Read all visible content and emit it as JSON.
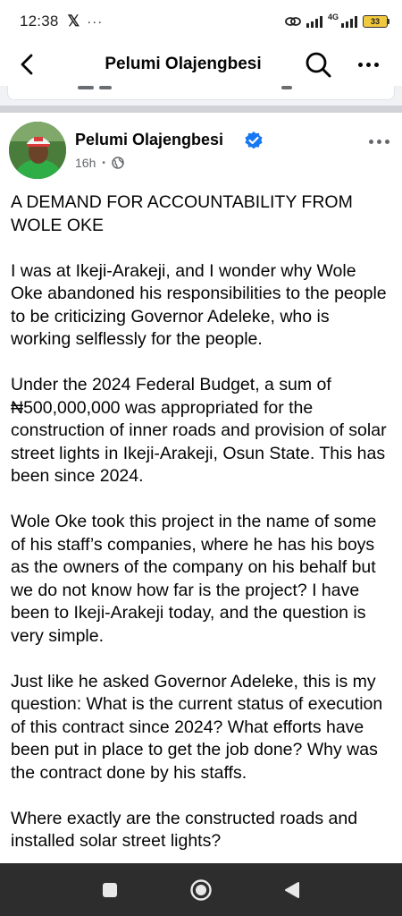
{
  "status_bar": {
    "time": "12:38",
    "x_glyph": "𝕏",
    "dots": "···",
    "network": "4G",
    "battery": "33"
  },
  "app_bar": {
    "title": "Pelumi Olajengbesi"
  },
  "post": {
    "author": "Pelumi Olajengbesi",
    "time": "16h",
    "separator": "•",
    "paragraphs": [
      "A DEMAND FOR ACCOUNTABILITY FROM WOLE OKE",
      "I was at Ikeji-Arakeji, and I wonder why Wole Oke abandoned his responsibilities to the people to be criticizing Governor Adeleke, who is working selflessly for the people.",
      "Under the 2024 Federal Budget, a sum of ₦500,000,000 was appropriated for the construction of inner roads and provision of solar street lights in Ikeji-Arakeji, Osun State. This has been since 2024.",
      "Wole Oke took this project in the name of some of his staff’s companies, where he has his boys as the owners of the company on his behalf but we do not know how far is the project? I have been to Ikeji-Arakeji today, and the question is very simple.",
      "Just like he asked Governor Adeleke, this is my question: What is the current status of execution of this contract since 2024? What efforts have been put in place to get the job done? Why was the contract done by his staffs.",
      "Where exactly are the constructed roads and installed solar street lights?"
    ]
  },
  "colors": {
    "text": "#050505",
    "secondary": "#65676b",
    "verified": "#1877f2",
    "nav_bar": "#2d2d2d"
  },
  "icons": [
    "back-arrow-icon",
    "search-icon",
    "more-icon",
    "verified-badge-icon",
    "globe-icon",
    "recents-icon",
    "home-icon",
    "back-nav-icon"
  ]
}
